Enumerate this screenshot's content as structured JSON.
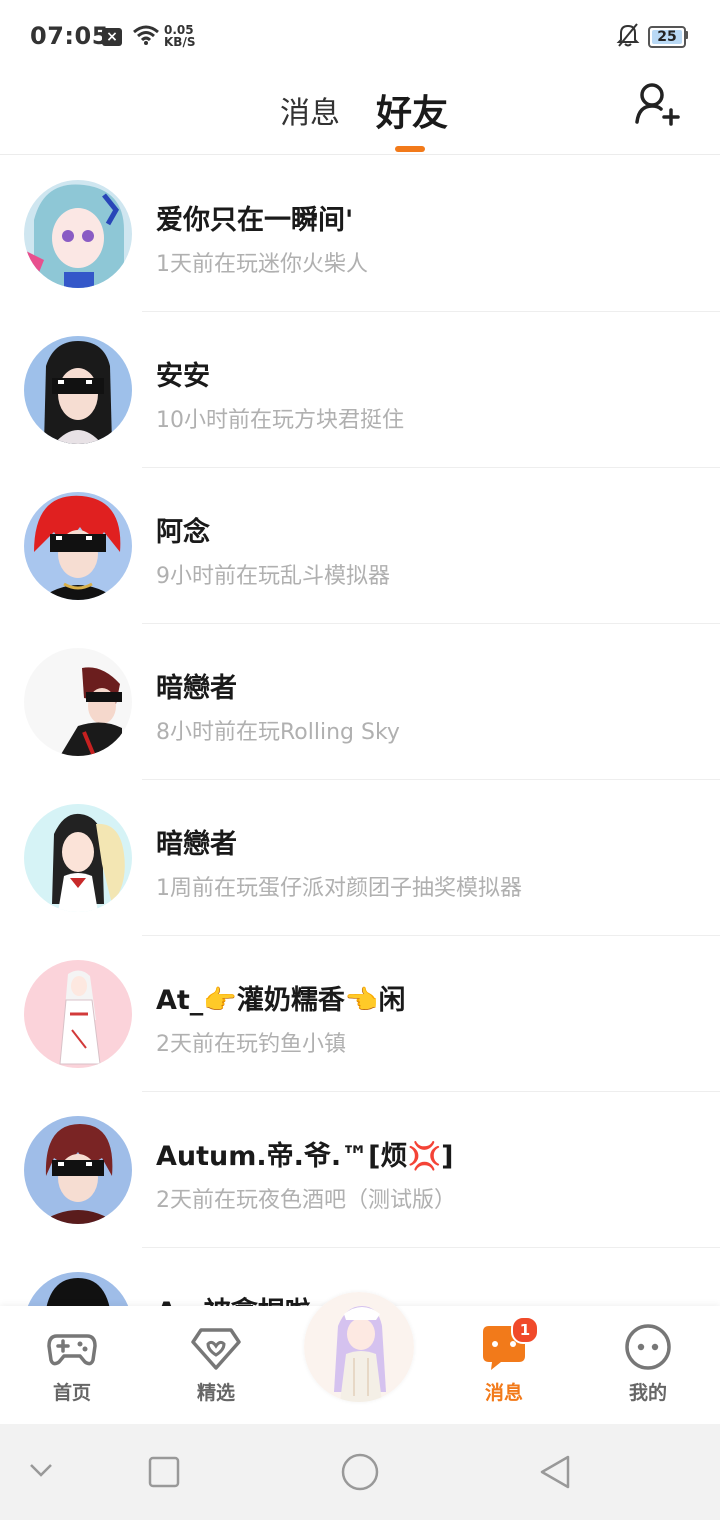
{
  "status_bar": {
    "time": "07:05",
    "net_speed_value": "0.05",
    "net_speed_unit": "KB/S",
    "battery": "25",
    "icons": [
      "close-box-icon",
      "wifi-icon",
      "bell-off-icon",
      "battery-icon"
    ]
  },
  "header": {
    "tabs": [
      {
        "label": "消息",
        "active": false
      },
      {
        "label": "好友",
        "active": true
      }
    ],
    "add_friend_icon": "add-user-icon",
    "accent": "#f27a1a"
  },
  "friends": [
    {
      "name": "爱你只在一瞬间'",
      "status": "1天前在玩迷你火柴人"
    },
    {
      "name": "安安",
      "status": "10小时前在玩方块君挺住"
    },
    {
      "name": "阿念",
      "status": "9小时前在玩乱斗模拟器"
    },
    {
      "name": "暗戀者",
      "status": "8小时前在玩Rolling Sky"
    },
    {
      "name": "暗戀者",
      "status": "1周前在玩蛋仔派对颜团子抽奖模拟器"
    },
    {
      "name": "At_👉灌奶糯香👈闲",
      "status": "2天前在玩钓鱼小镇"
    },
    {
      "name": "Autum.帝.爷.™[烦💢]",
      "status": "2天前在玩夜色酒吧（测试版）"
    },
    {
      "name": "A一被拿捏啦",
      "status": ""
    }
  ],
  "bottom_nav": {
    "items": [
      {
        "label": "首页",
        "icon": "gamepad-icon",
        "active": false
      },
      {
        "label": "精选",
        "icon": "heart-diamond-icon",
        "active": false
      },
      {
        "label": "消息",
        "icon": "chat-bubble-icon",
        "active": true,
        "badge": "1"
      },
      {
        "label": "我的",
        "icon": "face-icon",
        "active": false
      }
    ]
  },
  "system_nav": {
    "icons": [
      "chevron-down-icon",
      "recents-square-icon",
      "home-circle-icon",
      "back-triangle-icon"
    ]
  }
}
